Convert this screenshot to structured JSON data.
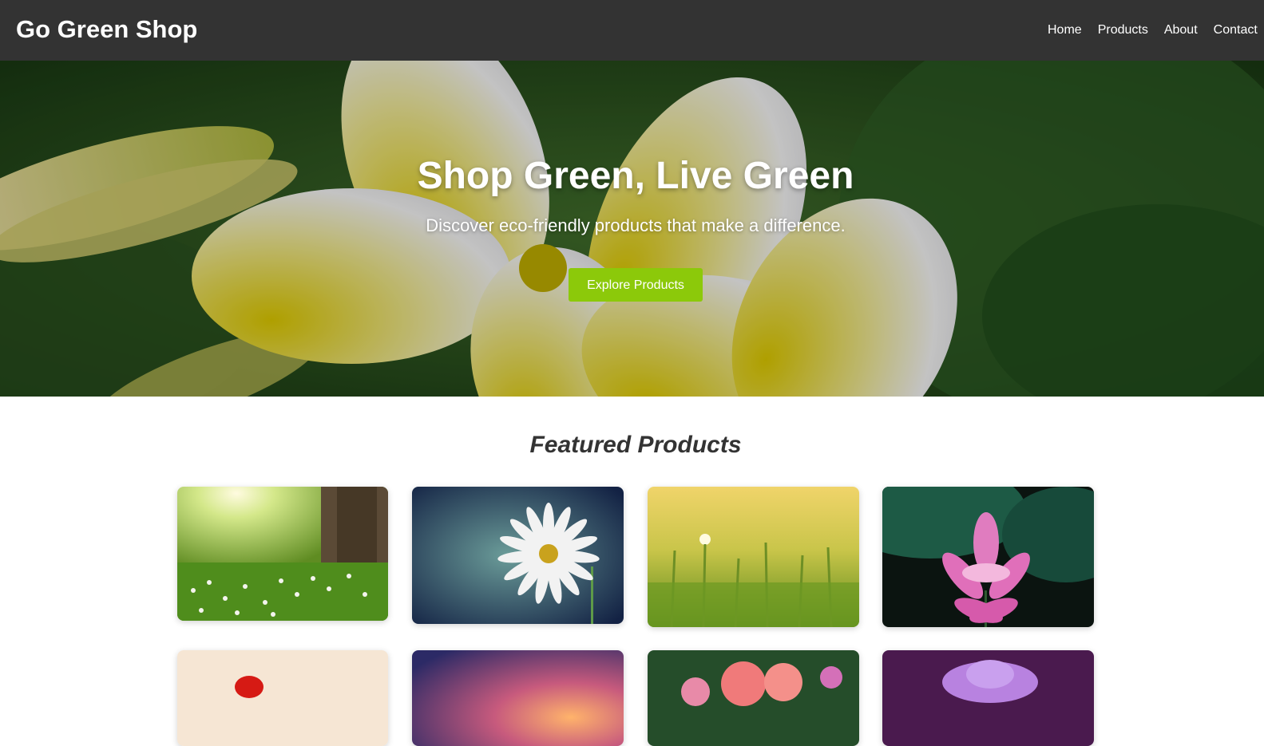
{
  "header": {
    "logo": "Go Green Shop",
    "nav": [
      "Home",
      "Products",
      "About",
      "Contact"
    ]
  },
  "hero": {
    "title": "Shop Green, Live Green",
    "subtitle": "Discover eco-friendly products that make a difference.",
    "button_label": "Explore Products"
  },
  "featured": {
    "title": "Featured Products",
    "products": [
      {
        "image": "meadow-sun-tree"
      },
      {
        "image": "white-daisy"
      },
      {
        "image": "wheat-field-sunset"
      },
      {
        "image": "pink-lotus"
      },
      {
        "image": "red-poppy"
      },
      {
        "image": "sunset-sky"
      },
      {
        "image": "pink-roses"
      },
      {
        "image": "purple-flower"
      }
    ]
  },
  "colors": {
    "header_bg": "#333333",
    "accent_button": "#8cc90a",
    "text_dark": "#333333"
  }
}
